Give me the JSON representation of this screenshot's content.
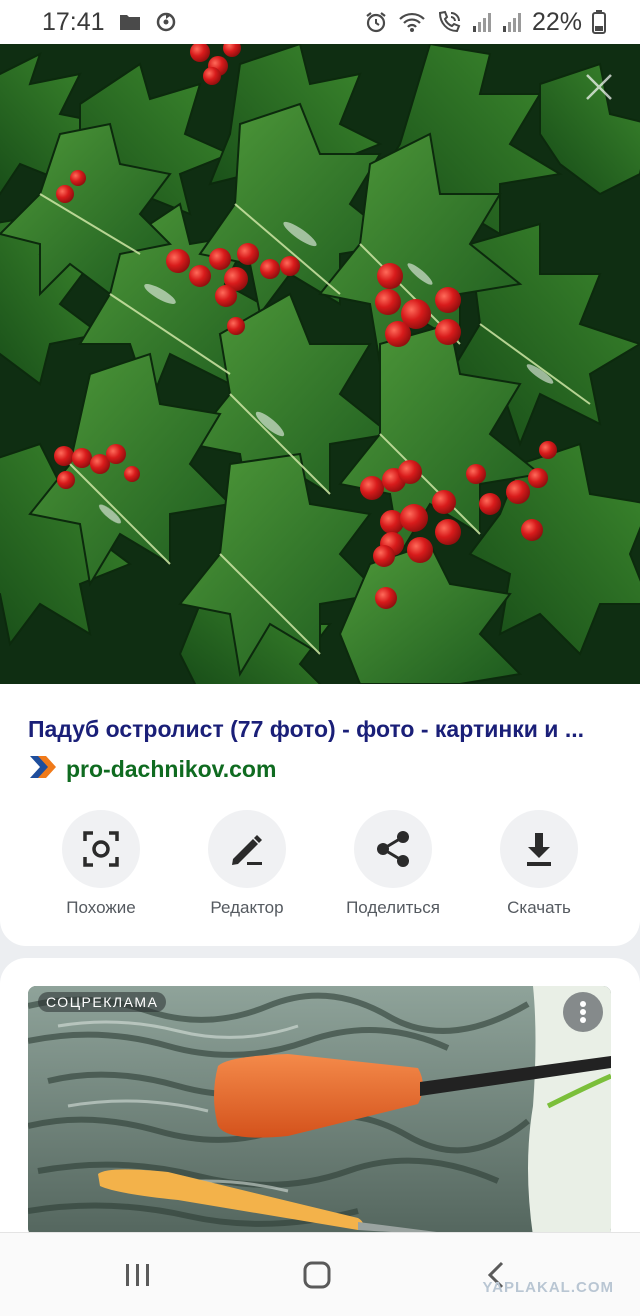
{
  "status_bar": {
    "time": "17:41",
    "battery": "22%",
    "left_icons": [
      "folder-icon",
      "sync-icon"
    ],
    "right_icons": [
      "alarm-icon",
      "wifi-icon",
      "wifi-calling-icon",
      "signal-icon",
      "signal-icon",
      "battery-icon"
    ]
  },
  "image_viewer": {
    "close_icon": "close-icon"
  },
  "result": {
    "title": "Падуб остролист (77 фото) - фото - картинки и ...",
    "source_icon": "pro-dachnikov-logo-icon",
    "source_domain": "pro-dachnikov.com"
  },
  "actions": [
    {
      "label": "Похожие",
      "icon": "lens-search-icon"
    },
    {
      "label": "Редактор",
      "icon": "pencil-icon"
    },
    {
      "label": "Поделиться",
      "icon": "share-icon"
    },
    {
      "label": "Скачать",
      "icon": "download-icon"
    }
  ],
  "ad": {
    "badge": "СОЦРЕКЛАМА",
    "menu_icon": "more-vertical-icon"
  },
  "nav_bar": {
    "icons": [
      "recent-apps-icon",
      "home-icon",
      "back-icon"
    ]
  },
  "watermark": "YAPLAKAL.COM",
  "colors": {
    "title": "#1a1f78",
    "domain": "#0f6b20",
    "logo_orange": "#f07a1a",
    "logo_blue": "#1f4e9c"
  }
}
